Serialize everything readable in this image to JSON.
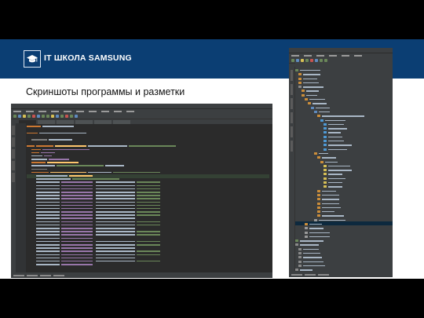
{
  "header": {
    "brand": "IT ШКОЛА SAMSUNG"
  },
  "slide": {
    "title": "Скриншоты программы и разметки"
  },
  "screens": {
    "main": "android-studio-code-editor",
    "side": "android-studio-project-tree"
  }
}
